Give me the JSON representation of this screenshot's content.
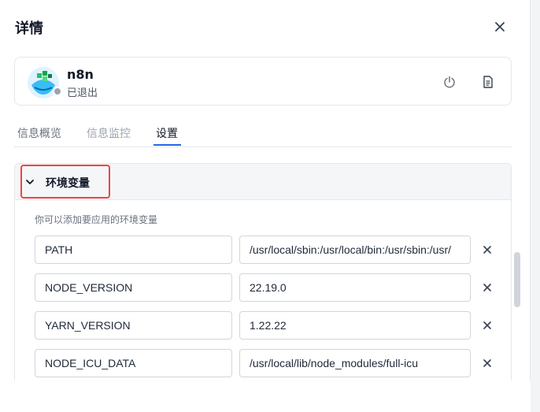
{
  "panel": {
    "title": "详情"
  },
  "app": {
    "name": "n8n",
    "status": "已退出",
    "status_color": "#9ca3af"
  },
  "tabs": [
    {
      "label": "信息概览",
      "state": "normal"
    },
    {
      "label": "信息监控",
      "state": "disabled"
    },
    {
      "label": "设置",
      "state": "active"
    }
  ],
  "env_section": {
    "title": "环境变量",
    "description": "你可以添加要应用的环境变量",
    "variables": [
      {
        "key": "PATH",
        "value": "/usr/local/sbin:/usr/local/bin:/usr/sbin:/usr/"
      },
      {
        "key": "NODE_VERSION",
        "value": "22.19.0"
      },
      {
        "key": "YARN_VERSION",
        "value": "1.22.22"
      },
      {
        "key": "NODE_ICU_DATA",
        "value": "/usr/local/lib/node_modules/full-icu"
      }
    ]
  },
  "icons": {
    "close": "close-icon",
    "power": "power-icon",
    "document": "document-icon",
    "chevron": "chevron-down-icon",
    "remove": "remove-icon"
  },
  "colors": {
    "accent": "#2563eb",
    "highlight": "#ef4444"
  }
}
